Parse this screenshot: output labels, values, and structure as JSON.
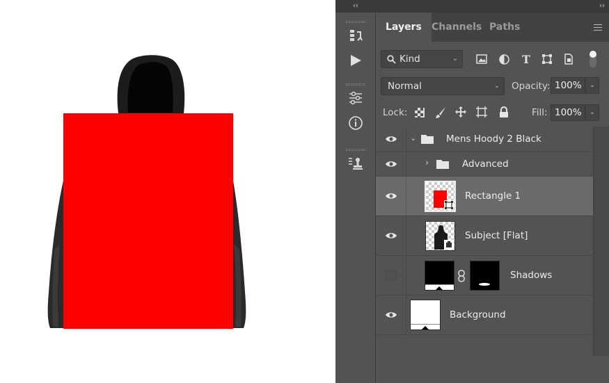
{
  "colors": {
    "panel_bg": "#535353",
    "tab_bar_bg": "#424242",
    "selected_row": "#6a6a6a",
    "red_rectangle": "#fe0000"
  },
  "toolbar": {
    "collapse_left": "‹‹",
    "collapse_right": "››",
    "tools": [
      "history-icon",
      "play-actions-icon",
      "adjustments-sliders-icon",
      "info-icon",
      "clone-source-icon"
    ]
  },
  "tabs": [
    {
      "label": "Layers",
      "active": true
    },
    {
      "label": "Channels",
      "active": false
    },
    {
      "label": "Paths",
      "active": false
    }
  ],
  "filter": {
    "kind_label": "Kind",
    "icons": [
      "pixel-filter-icon",
      "adjustment-filter-icon",
      "type-filter-icon",
      "shape-filter-icon",
      "smart-object-filter-icon",
      "filter-toggle-icon"
    ]
  },
  "blend": {
    "mode": "Normal",
    "opacity_label": "Opacity:",
    "opacity_value": "100%"
  },
  "lock": {
    "label": "Lock:",
    "fill_label": "Fill:",
    "fill_value": "100%",
    "icons": [
      "lock-transparent-icon",
      "lock-paint-icon",
      "lock-position-icon",
      "lock-artboard-icon",
      "lock-all-icon"
    ]
  },
  "layers": [
    {
      "name": "Mens Hoody 2 Black",
      "type": "group",
      "expanded": true,
      "visible": true
    },
    {
      "name": "Advanced",
      "type": "group",
      "expanded": false,
      "visible": true
    },
    {
      "name": "Rectangle 1",
      "type": "smart-object",
      "visible": true,
      "selected": true
    },
    {
      "name": "Subject [Flat]",
      "type": "smart-object",
      "visible": true
    },
    {
      "name": "Shadows",
      "type": "masked",
      "visible": false
    },
    {
      "name": "Background",
      "type": "fill",
      "visible": true
    }
  ]
}
